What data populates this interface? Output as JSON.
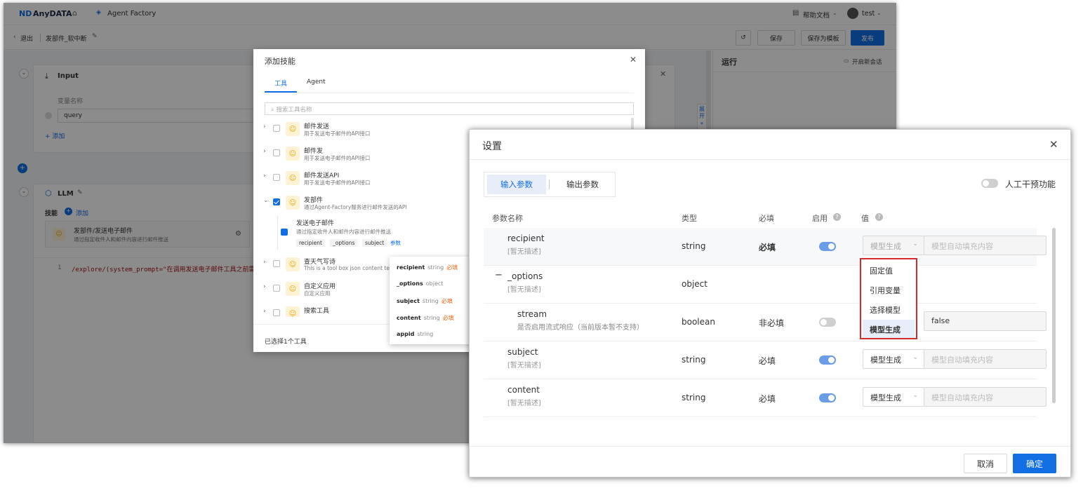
{
  "topbar": {
    "logo": "AnyDATA",
    "app_name": "Agent Factory",
    "help": "帮助文档",
    "user": "test"
  },
  "subbar": {
    "back": "退出",
    "title": "发部件_软中断",
    "save": "保存",
    "save_template": "保存为模板",
    "publish": "发布"
  },
  "canvas": {
    "input_node": {
      "title": "Input",
      "var_label": "变量名称",
      "var_value": "query",
      "add": "添加"
    },
    "llm_node": {
      "title": "LLM",
      "skills_label": "技能",
      "add": "添加",
      "skill_name": "发部件/发送电子邮件",
      "skill_desc": "通过指定收件人和邮件内容进行邮件推送",
      "code_line_no": "1",
      "code_text": "/explore/(system_prompt=\"在调用发送电子邮件工具之前需"
    }
  },
  "run_panel": {
    "title": "运行",
    "new_chat": "开启新会话",
    "expand": "展开"
  },
  "add_skill": {
    "title": "添加技能",
    "tabs": [
      "工具",
      "Agent"
    ],
    "search_placeholder": "搜索工具名称",
    "tools": [
      {
        "name": "邮件发送",
        "desc": "用于发送电子邮件的API接口"
      },
      {
        "name": "邮件发",
        "desc": "用于发送电子邮件的API接口"
      },
      {
        "name": "邮件发送API",
        "desc": "用于发送电子邮件的API接口"
      },
      {
        "name": "发部件",
        "desc": "通过Agent-Factory服务进行邮件发送的API"
      },
      {
        "name": "查天气写诗",
        "desc": "This is a tool box json content test"
      },
      {
        "name": "自定义应用",
        "desc": "自定义应用"
      },
      {
        "name": "搜索工具",
        "desc": ""
      }
    ],
    "sub_tool": {
      "name": "发送电子邮件",
      "desc": "通过指定收件人和邮件内容进行邮件推送",
      "tags": [
        "recipient",
        "_options",
        "subject"
      ],
      "params_link": "参数"
    },
    "footer": "已选择1个工具",
    "param_popover": [
      {
        "name": "recipient",
        "type": "string",
        "req": "必填"
      },
      {
        "name": "_options",
        "type": "object",
        "req": ""
      },
      {
        "name": "subject",
        "type": "string",
        "req": "必填"
      },
      {
        "name": "content",
        "type": "string",
        "req": "必填"
      },
      {
        "name": "appid",
        "type": "string",
        "req": ""
      }
    ]
  },
  "settings": {
    "title": "设置",
    "tab_input": "输入参数",
    "tab_output": "输出参数",
    "human_toggle": "人工干预功能",
    "headers": {
      "name": "参数名称",
      "type": "类型",
      "required": "必填",
      "enabled": "启用",
      "value": "值"
    },
    "rows": [
      {
        "name": "recipient",
        "desc": "[暂无描述]",
        "type": "string",
        "req": "必填",
        "enabled": true,
        "mode": "模型生成",
        "value": "模型自动填充内容"
      },
      {
        "name": "_options",
        "desc": "[暂无描述]",
        "type": "object",
        "req": "",
        "collapse": "−"
      },
      {
        "name": "stream",
        "desc": "是否启用流式响应（当前版本暂不支持）",
        "type": "boolean",
        "req": "非必填",
        "enabled": false,
        "value": "false"
      },
      {
        "name": "subject",
        "desc": "[暂无描述]",
        "type": "string",
        "req": "必填",
        "enabled": true,
        "mode": "模型生成",
        "value": "模型自动填充内容"
      },
      {
        "name": "content",
        "desc": "[暂无描述]",
        "type": "string",
        "req": "必填",
        "enabled": true,
        "mode": "模型生成",
        "value": "模型自动填充内容"
      }
    ],
    "dropdown": [
      "固定值",
      "引用变量",
      "选择模型",
      "模型生成"
    ],
    "cancel": "取消",
    "ok": "确定"
  }
}
